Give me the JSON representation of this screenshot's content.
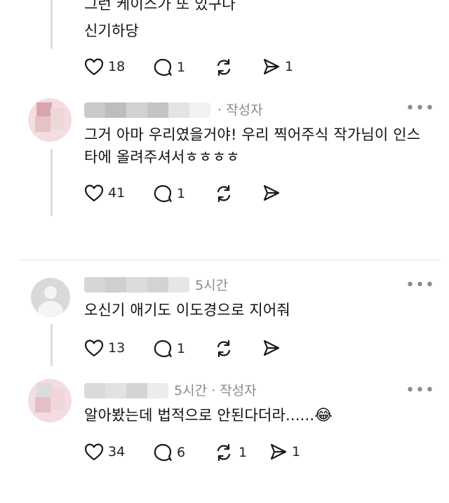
{
  "comments": [
    {
      "id": "c1",
      "lines": [
        "그런 케이스가 또 있구나",
        "신기하당"
      ],
      "likes": "18",
      "replies": "1",
      "reposts": "",
      "shares": "1"
    },
    {
      "id": "c2",
      "meta": "· 작성자",
      "lines": [
        "그거 아마 우리였을거야! 우리 찍어주식 작가님이 인스",
        "타에 올려주셔서ㅎㅎㅎㅎ"
      ],
      "likes": "41",
      "replies": "1",
      "reposts": "",
      "shares": ""
    },
    {
      "id": "c3",
      "meta": "5시간",
      "lines": [
        "오신기 애기도 이도경으로 지어줘"
      ],
      "likes": "13",
      "replies": "1",
      "reposts": "",
      "shares": ""
    },
    {
      "id": "c4",
      "meta": "5시간 · 작성자",
      "lines": [
        "알아봤는데 법적으로 안된다더라......"
      ],
      "emoji": "😂",
      "likes": "34",
      "replies": "6",
      "reposts": "1",
      "shares": "1"
    }
  ],
  "more_label": "•••",
  "icons": [
    "heart-icon",
    "comment-icon",
    "repost-icon",
    "share-icon",
    "more-icon"
  ]
}
